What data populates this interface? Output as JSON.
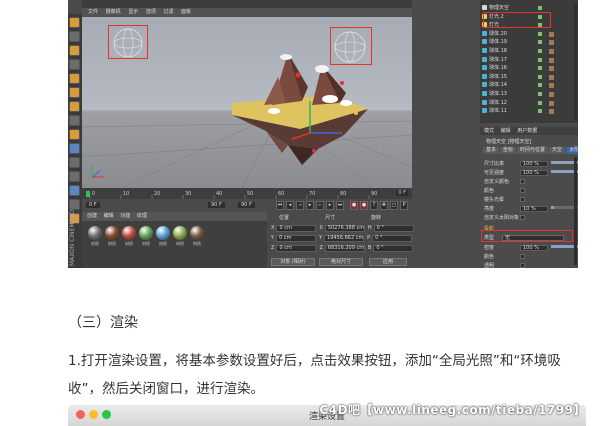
{
  "app": {
    "menu": [
      "文件",
      "摄像机",
      "显示",
      "选项",
      "过滤",
      "面板"
    ],
    "brand": "MAXON CINEMA4D"
  },
  "timeline": {
    "ticks": [
      "0",
      "10",
      "20",
      "30",
      "40",
      "50",
      "60",
      "70",
      "80",
      "90"
    ],
    "frame_readout": "0 F",
    "start_field": "0 F",
    "end_field": "90 F",
    "end_field2": "90 F"
  },
  "materials": {
    "menu": [
      "创建",
      "编辑",
      "功能",
      "纹理"
    ],
    "balls": [
      {
        "label": "材质",
        "color": "#6d6f72"
      },
      {
        "label": "材质",
        "color": "#8a4a2e"
      },
      {
        "label": "材质",
        "color": "#c04b3d"
      },
      {
        "label": "材质",
        "color": "#5fa35a"
      },
      {
        "label": "材质",
        "color": "#5c9fd6"
      },
      {
        "label": "材质",
        "color": "#8aa84a"
      },
      {
        "label": "材质",
        "color": "#7a5a42"
      }
    ]
  },
  "coordinates": {
    "headers": [
      "位置",
      "尺寸",
      "旋转"
    ],
    "rows": [
      {
        "axis": "X",
        "pos": "0 cm",
        "size_axis": "X",
        "size": "50276.388 cm",
        "rot_axis": "H",
        "rot": "0 °"
      },
      {
        "axis": "Y",
        "pos": "0 cm",
        "size_axis": "Y",
        "size": "19456.662 cm",
        "rot_axis": "P",
        "rot": "0 °"
      },
      {
        "axis": "Z",
        "pos": "0 cm",
        "size_axis": "Z",
        "size": "68316.209 cm",
        "rot_axis": "B",
        "rot": "0 °"
      }
    ],
    "mode_left": "对象 (相对)",
    "mode_right": "绝对尺寸",
    "apply": "应用"
  },
  "objects": {
    "rows": [
      {
        "name": "物理天空",
        "color": "#d8d8d8"
      },
      {
        "name": "灯光.2",
        "color": "#f0d24a"
      },
      {
        "name": "灯光",
        "color": "#f0d24a"
      },
      {
        "name": "球体.20",
        "color": "#4bb4d6"
      },
      {
        "name": "球体.19",
        "color": "#4bb4d6"
      },
      {
        "name": "球体.18",
        "color": "#4bb4d6"
      },
      {
        "name": "球体.17",
        "color": "#4bb4d6"
      },
      {
        "name": "球体.16",
        "color": "#4bb4d6"
      },
      {
        "name": "球体.15",
        "color": "#4bb4d6"
      },
      {
        "name": "球体.14",
        "color": "#4bb4d6"
      },
      {
        "name": "球体.13",
        "color": "#4bb4d6"
      },
      {
        "name": "球体.12",
        "color": "#4bb4d6"
      },
      {
        "name": "球体.11",
        "color": "#4bb4d6"
      }
    ]
  },
  "attributes": {
    "menu": [
      "模式",
      "编辑",
      "用户数据"
    ],
    "title": "物理天空 [物理天空]",
    "tabs": [
      "基本",
      "坐标",
      "时间与位置",
      "天空",
      "太阳",
      "细节"
    ],
    "active_tab": "太阳",
    "rows": [
      {
        "label": "尺寸比率",
        "value": "100 %"
      },
      {
        "label": "可见强度",
        "value": "100 %"
      },
      {
        "label": "自定义颜色",
        "value": ""
      },
      {
        "label": "颜色",
        "value": ""
      },
      {
        "label": "镜头光晕",
        "value": ""
      },
      {
        "label": "亮度",
        "value": "10 %"
      },
      {
        "label": "自定义太阳对象",
        "value": ""
      }
    ],
    "section_label": "投影",
    "highlight_label": "类型",
    "highlight_value": "无",
    "rows_after": [
      {
        "label": "密度",
        "value": "100 %"
      },
      {
        "label": "颜色",
        "value": ""
      },
      {
        "label": "透明",
        "value": ""
      }
    ]
  },
  "article": {
    "heading": "（三）渲染",
    "paragraph": "1.打开渲染设置，将基本参数设置好后，点击效果按钮，添加“全局光照”和“环境吸收”，然后关闭窗口，进行渲染。"
  },
  "window": {
    "title": "渲染设置",
    "lights": [
      "#fc5f57",
      "#fdbc2e",
      "#28c840"
    ]
  },
  "watermark": "C4D吧【www.lineeg.com/tieba/1799】"
}
